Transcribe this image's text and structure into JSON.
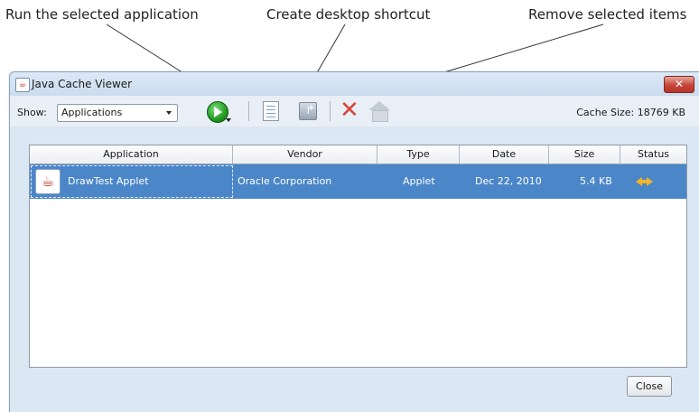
{
  "annotations": {
    "run": "Run the selected application",
    "shortcut": "Create desktop shortcut",
    "remove": "Remove selected items"
  },
  "window": {
    "title": "Java Cache Viewer",
    "close_glyph": "✕"
  },
  "toolbar": {
    "show_label": "Show:",
    "show_value": "Applications",
    "cache_size": "Cache Size:  18769 KB",
    "icons": [
      "play-run-icon",
      "dropdown-arrow-icon",
      "document-details-icon",
      "desktop-shortcut-icon",
      "remove-x-icon",
      "home-icon"
    ]
  },
  "table": {
    "columns": [
      "Application",
      "Vendor",
      "Type",
      "Date",
      "Size",
      "Status"
    ],
    "rows": [
      {
        "application": "DrawTest Applet",
        "vendor": "Oracle Corporation",
        "type": "Applet",
        "date": "Dec 22, 2010",
        "size": "5.4 KB",
        "status_icon": "update-arrows-icon"
      }
    ]
  },
  "buttons": {
    "close": "Close"
  },
  "colors": {
    "selection": "#4a86c8",
    "window_bg": "#dbe7f3",
    "close_x": "#c6453a",
    "run_green": "#219a21",
    "remove_red": "#d9453a",
    "status_orange": "#f0b52a"
  }
}
